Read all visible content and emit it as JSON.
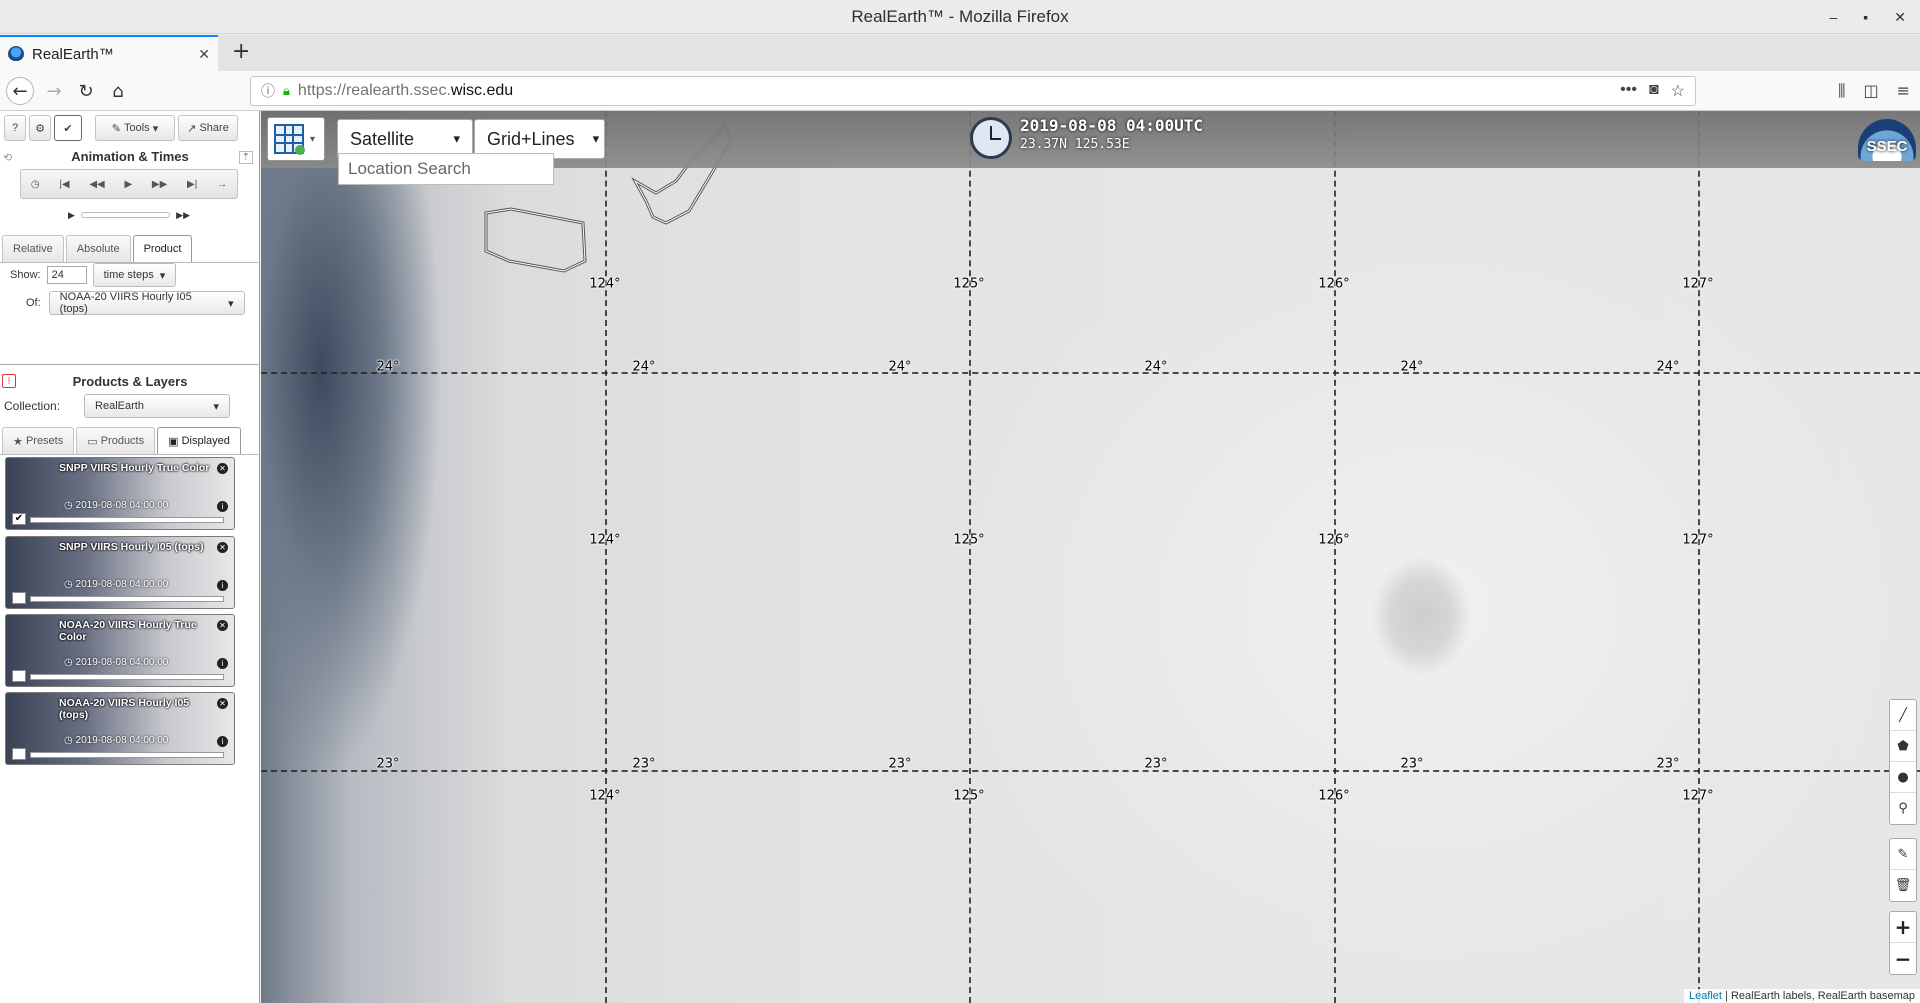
{
  "window": {
    "title": "RealEarth™ - Mozilla Firefox"
  },
  "browser": {
    "tab_title": "RealEarth™",
    "url_prefix": "https://realearth.ssec.",
    "url_host": "wisc.edu"
  },
  "sidebar": {
    "toolbar": {
      "tools_label": "Tools",
      "share_label": "Share"
    },
    "animation_title": "Animation & Times",
    "time_tabs": [
      "Relative",
      "Absolute",
      "Product"
    ],
    "show_label": "Show:",
    "show_value": "24",
    "time_steps_label": "time steps",
    "of_label": "Of:",
    "of_value": "NOAA-20 VIIRS Hourly I05 (tops)",
    "products_title": "Products & Layers",
    "collection_label": "Collection:",
    "collection_value": "RealEarth",
    "layer_tabs": [
      "Presets",
      "Products",
      "Displayed"
    ],
    "layers": [
      {
        "name": "SNPP VIIRS Hourly True Color",
        "time": "2019-08-08 04:00:00",
        "checked": "✔"
      },
      {
        "name": "SNPP VIIRS Hourly I05 (tops)",
        "time": "2019-08-08 04:00:00",
        "checked": ""
      },
      {
        "name": "NOAA-20 VIIRS Hourly True Color",
        "time": "2019-08-08 04:00:00",
        "checked": ""
      },
      {
        "name": "NOAA-20 VIIRS Hourly I05 (tops)",
        "time": "2019-08-08 04:00:00",
        "checked": ""
      }
    ]
  },
  "map": {
    "basemap_label": "Satellite",
    "overlay_label": "Grid+Lines",
    "search_placeholder": "Location Search",
    "timestamp": "2019-08-08 04:00UTC",
    "coords": "23.37N 125.53E",
    "logo_text": "SSEC",
    "lon_labels": [
      "124°",
      "125°",
      "126°",
      "127°"
    ],
    "lat_labels": [
      "24°",
      "23°"
    ],
    "attribution_link": "Leaflet",
    "attribution_text": " | RealEarth labels, RealEarth basemap"
  }
}
